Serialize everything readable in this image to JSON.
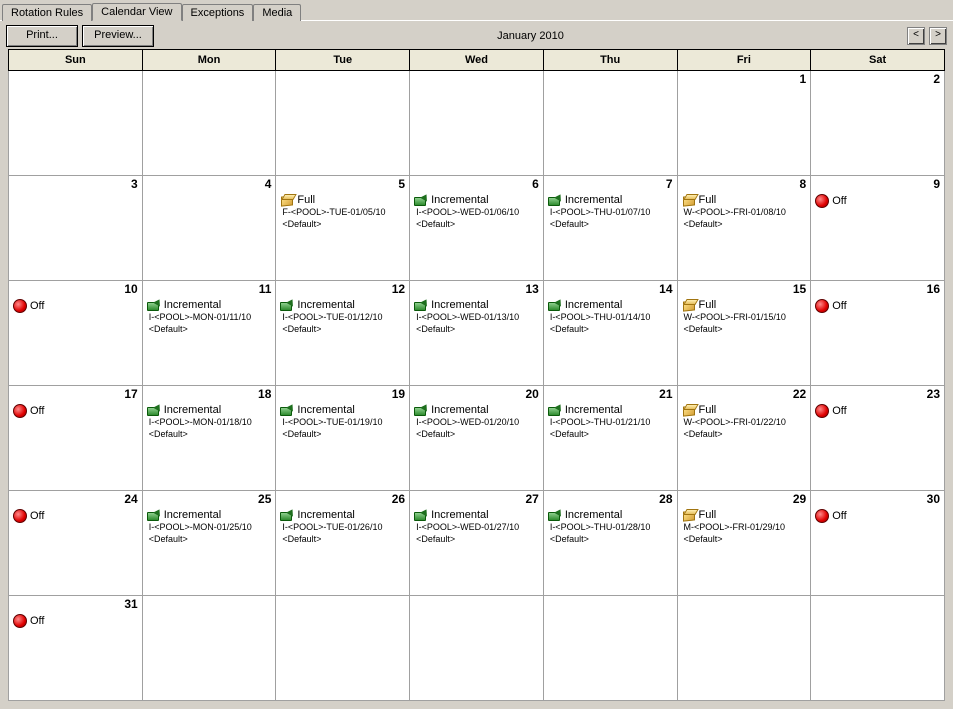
{
  "tabs": [
    "Rotation Rules",
    "Calendar View",
    "Exceptions",
    "Media"
  ],
  "active_tab_index": 1,
  "toolbar": {
    "print": "Print...",
    "preview": "Preview..."
  },
  "nav": {
    "prev": "<",
    "next": ">"
  },
  "title": "January 2010",
  "day_headers": [
    "Sun",
    "Mon",
    "Tue",
    "Wed",
    "Thu",
    "Fri",
    "Sat"
  ],
  "event_labels": {
    "default": "<Default>"
  },
  "weeks": [
    [
      {
        "day": null
      },
      {
        "day": null
      },
      {
        "day": null
      },
      {
        "day": null
      },
      {
        "day": null
      },
      {
        "day": 1
      },
      {
        "day": 2
      }
    ],
    [
      {
        "day": 3
      },
      {
        "day": 4
      },
      {
        "day": 5,
        "type": "full",
        "title": "Full",
        "line": "F-<POOL>-TUE-01/05/10",
        "def": true
      },
      {
        "day": 6,
        "type": "inc",
        "title": "Incremental",
        "line": "I-<POOL>-WED-01/06/10",
        "def": true
      },
      {
        "day": 7,
        "type": "inc",
        "title": "Incremental",
        "line": "I-<POOL>-THU-01/07/10",
        "def": true
      },
      {
        "day": 8,
        "type": "full",
        "title": "Full",
        "line": "W-<POOL>-FRI-01/08/10",
        "def": true
      },
      {
        "day": 9,
        "type": "off",
        "title": "Off"
      }
    ],
    [
      {
        "day": 10,
        "type": "off",
        "title": "Off"
      },
      {
        "day": 11,
        "type": "inc",
        "title": "Incremental",
        "line": "I-<POOL>-MON-01/11/10",
        "def": true
      },
      {
        "day": 12,
        "type": "inc",
        "title": "Incremental",
        "line": "I-<POOL>-TUE-01/12/10",
        "def": true
      },
      {
        "day": 13,
        "type": "inc",
        "title": "Incremental",
        "line": "I-<POOL>-WED-01/13/10",
        "def": true
      },
      {
        "day": 14,
        "type": "inc",
        "title": "Incremental",
        "line": "I-<POOL>-THU-01/14/10",
        "def": true
      },
      {
        "day": 15,
        "type": "full",
        "title": "Full",
        "line": "W-<POOL>-FRI-01/15/10",
        "def": true
      },
      {
        "day": 16,
        "type": "off",
        "title": "Off"
      }
    ],
    [
      {
        "day": 17,
        "type": "off",
        "title": "Off"
      },
      {
        "day": 18,
        "type": "inc",
        "title": "Incremental",
        "line": "I-<POOL>-MON-01/18/10",
        "def": true
      },
      {
        "day": 19,
        "type": "inc",
        "title": "Incremental",
        "line": "I-<POOL>-TUE-01/19/10",
        "def": true
      },
      {
        "day": 20,
        "type": "inc",
        "title": "Incremental",
        "line": "I-<POOL>-WED-01/20/10",
        "def": true
      },
      {
        "day": 21,
        "type": "inc",
        "title": "Incremental",
        "line": "I-<POOL>-THU-01/21/10",
        "def": true
      },
      {
        "day": 22,
        "type": "full",
        "title": "Full",
        "line": "W-<POOL>-FRI-01/22/10",
        "def": true
      },
      {
        "day": 23,
        "type": "off",
        "title": "Off"
      }
    ],
    [
      {
        "day": 24,
        "type": "off",
        "title": "Off"
      },
      {
        "day": 25,
        "type": "inc",
        "title": "Incremental",
        "line": "I-<POOL>-MON-01/25/10",
        "def": true
      },
      {
        "day": 26,
        "type": "inc",
        "title": "Incremental",
        "line": "I-<POOL>-TUE-01/26/10",
        "def": true
      },
      {
        "day": 27,
        "type": "inc",
        "title": "Incremental",
        "line": "I-<POOL>-WED-01/27/10",
        "def": true
      },
      {
        "day": 28,
        "type": "inc",
        "title": "Incremental",
        "line": "I-<POOL>-THU-01/28/10",
        "def": true
      },
      {
        "day": 29,
        "type": "full",
        "title": "Full",
        "line": "M-<POOL>-FRI-01/29/10",
        "def": true
      },
      {
        "day": 30,
        "type": "off",
        "title": "Off"
      }
    ],
    [
      {
        "day": 31,
        "type": "off",
        "title": "Off"
      },
      {
        "day": null
      },
      {
        "day": null
      },
      {
        "day": null
      },
      {
        "day": null
      },
      {
        "day": null
      },
      {
        "day": null
      }
    ]
  ]
}
